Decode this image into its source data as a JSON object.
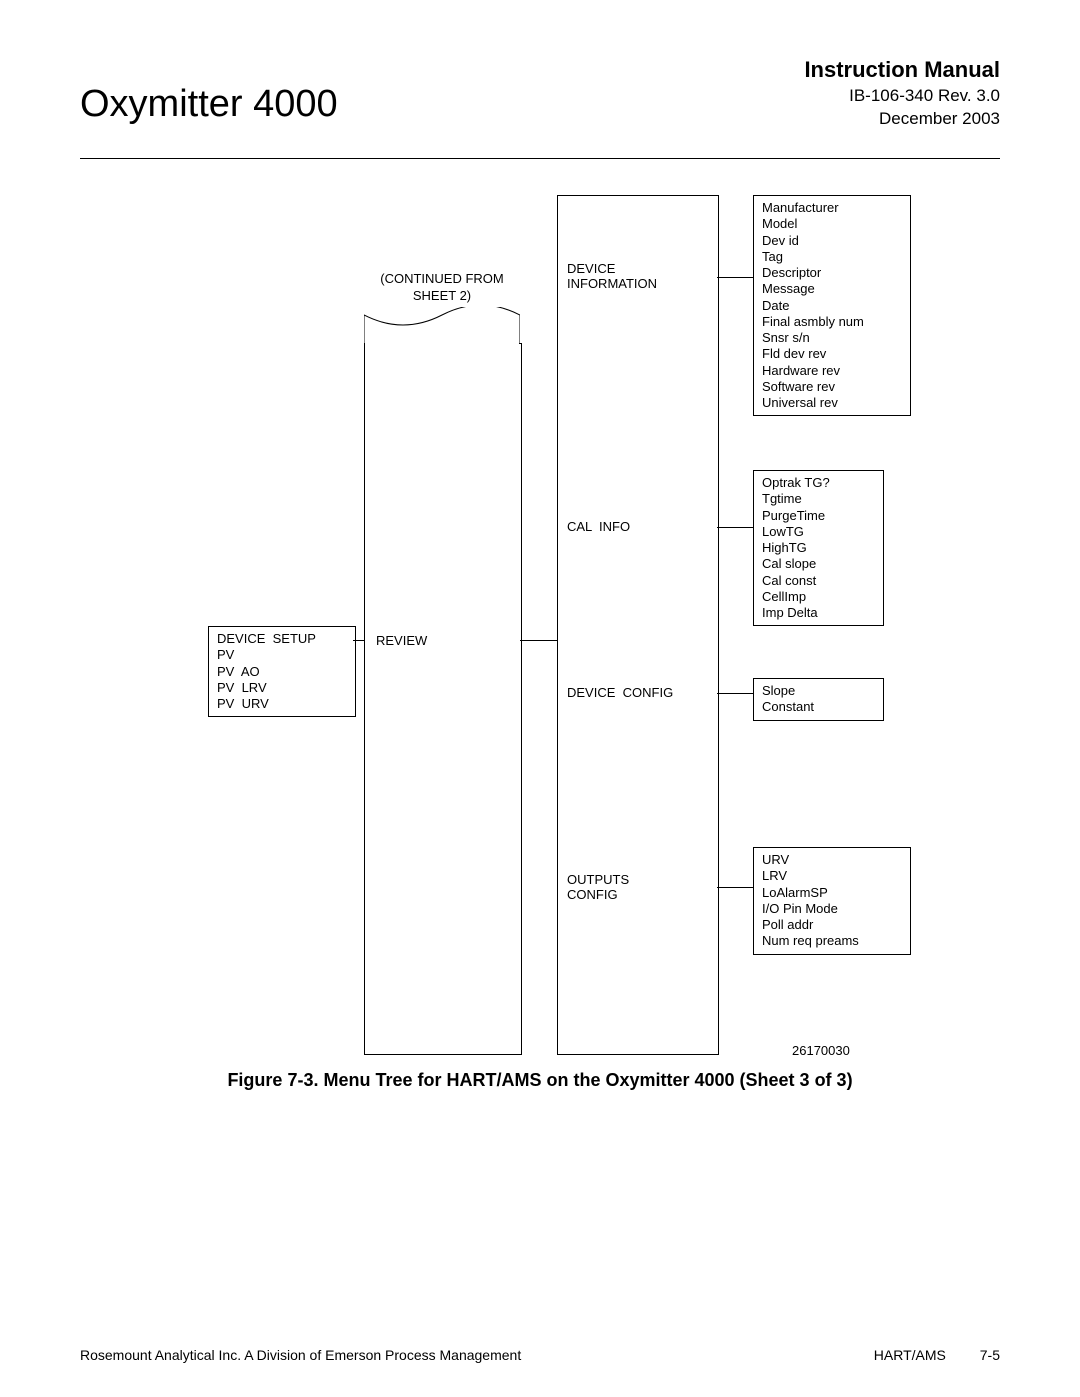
{
  "header": {
    "product": "Oxymitter 4000",
    "manual": "Instruction Manual",
    "docrev": "IB-106-340  Rev. 3.0",
    "date": "December 2003"
  },
  "diagram": {
    "continued_note": "(CONTINUED  FROM\nSHEET  2)",
    "review_label": "REVIEW",
    "device_setup_lines": "DEVICE  SETUP\nPV\nPV  AO\nPV  LRV\nPV  URV",
    "mid_labels": {
      "device_info": "DEVICE\nINFORMATION",
      "cal_info": "CAL  INFO",
      "device_config": "DEVICE  CONFIG",
      "outputs_config": "OUTPUTS\nCONFIG"
    },
    "right_boxes": {
      "device_info": "Manufacturer\nModel\nDev id\nTag\nDescriptor\nMessage\nDate\nFinal asmbly num\nSnsr s/n\nFld dev rev\nHardware rev\nSoftware rev\nUniversal rev",
      "cal_info": "Optrak TG?\nTgtime\nPurgeTime\nLowTG\nHighTG\nCal slope\nCal const\nCellImp\nImp Delta",
      "device_config": "Slope\nConstant",
      "outputs_config": "URV\nLRV\nLoAlarmSP\nI/O Pin Mode\nPoll addr\nNum req preams"
    },
    "drawing_id": "26170030"
  },
  "caption": "Figure 7-3.  Menu Tree for HART/AMS on the Oxymitter 4000 (Sheet 3 of 3)",
  "footer": {
    "left": "Rosemount Analytical Inc.    A Division of Emerson Process Management",
    "section": "HART/AMS",
    "page": "7-5"
  }
}
